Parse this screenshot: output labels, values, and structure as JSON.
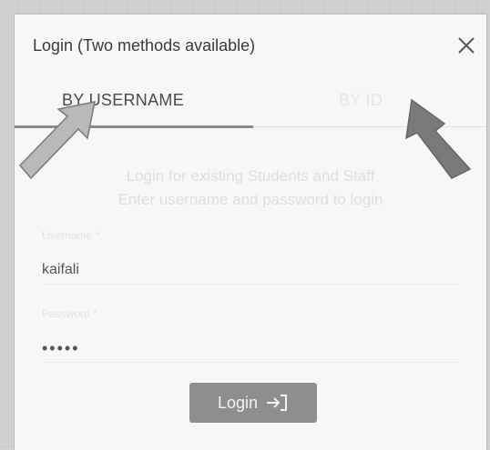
{
  "dialog": {
    "title": "Login (Two methods available)",
    "close_icon": "close-icon"
  },
  "tabs": [
    {
      "label": "BY USERNAME",
      "active": true
    },
    {
      "label": "BY ID",
      "active": false
    }
  ],
  "info": {
    "line1": "Login for existing Students and Staff",
    "line2": "Enter username and password to login"
  },
  "form": {
    "username_label": "Username *",
    "username_value": "kaifali",
    "password_label": "Password *",
    "password_value": "•••••"
  },
  "login_button": {
    "label": "Login",
    "icon": "login-arrow-icon"
  },
  "annotations": {
    "arrow_icon": "pointer-arrow-icon"
  },
  "colors": {
    "tab_indicator": "#8a8a8a",
    "button_bg": "#8e8e8e"
  }
}
